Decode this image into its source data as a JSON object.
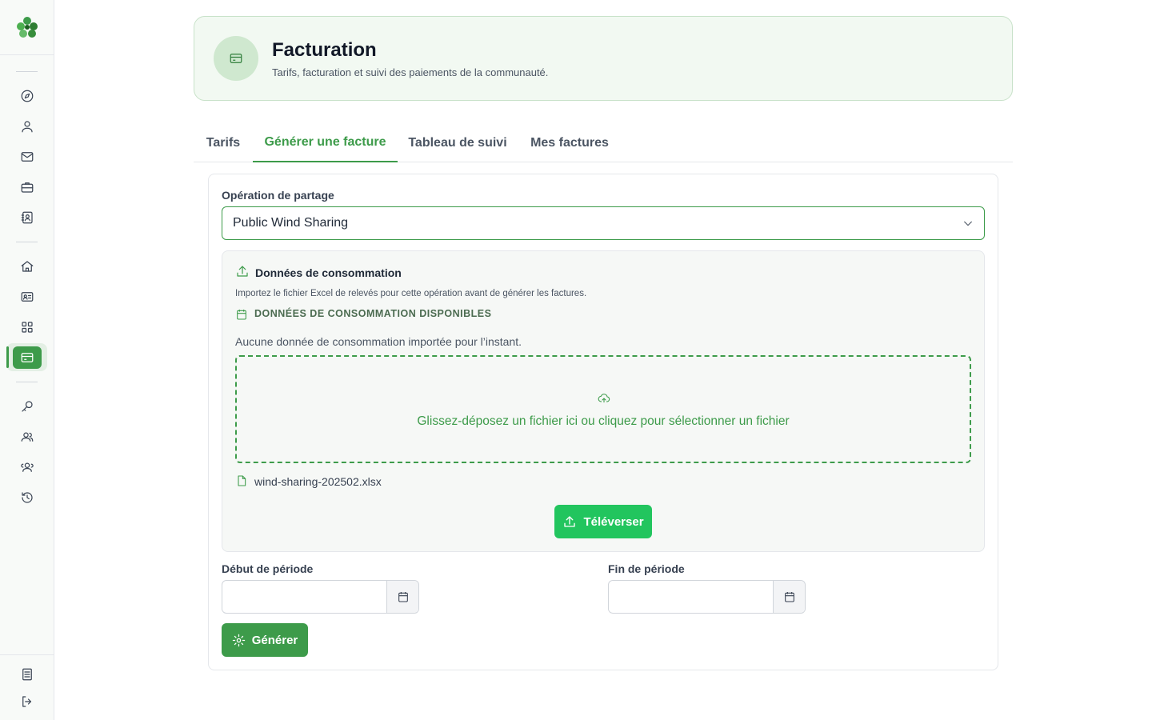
{
  "colors": {
    "accent": "#3d9b4a",
    "upload": "#22c55e",
    "header_bg": "#f2f9f2"
  },
  "sidebar": {
    "logo_icon": "clover-logo-icon",
    "items": [
      {
        "icon": "compass-icon"
      },
      {
        "icon": "user-icon"
      },
      {
        "icon": "mail-icon"
      },
      {
        "icon": "briefcase-icon"
      },
      {
        "icon": "contact-book-icon"
      },
      {
        "icon": "home-icon"
      },
      {
        "icon": "id-card-icon"
      },
      {
        "icon": "grid-icon"
      },
      {
        "icon": "billing-card-icon",
        "active": true
      },
      {
        "icon": "key-icon"
      },
      {
        "icon": "users-icon"
      },
      {
        "icon": "group-icon"
      },
      {
        "icon": "history-icon"
      },
      {
        "icon": "document-icon"
      },
      {
        "icon": "logout-icon"
      }
    ]
  },
  "header": {
    "title": "Facturation",
    "subtitle": "Tarifs, facturation et suivi des paiements de la communauté."
  },
  "tabs": [
    {
      "label": "Tarifs"
    },
    {
      "label": "Générer une facture",
      "active": true
    },
    {
      "label": "Tableau de suivi"
    },
    {
      "label": "Mes factures"
    }
  ],
  "form": {
    "operation_label": "Opération de partage",
    "operation_value": "Public Wind Sharing",
    "consumption": {
      "title": "Données de consommation",
      "description": "Importez le fichier Excel de relevés pour cette opération avant de générer les factures.",
      "available_label": "DONNÉES DE CONSOMMATION DISPONIBLES",
      "empty_text": "Aucune donnée de consommation importée pour l’instant.",
      "dropzone_text": "Glissez-déposez un fichier ici ou cliquez pour sélectionner un fichier",
      "file_name": "wind-sharing-202502.xlsx",
      "upload_label": "Téléverser"
    },
    "start_label": "Début de période",
    "start_value": "",
    "end_label": "Fin de période",
    "end_value": "",
    "generate_label": "Générer"
  }
}
